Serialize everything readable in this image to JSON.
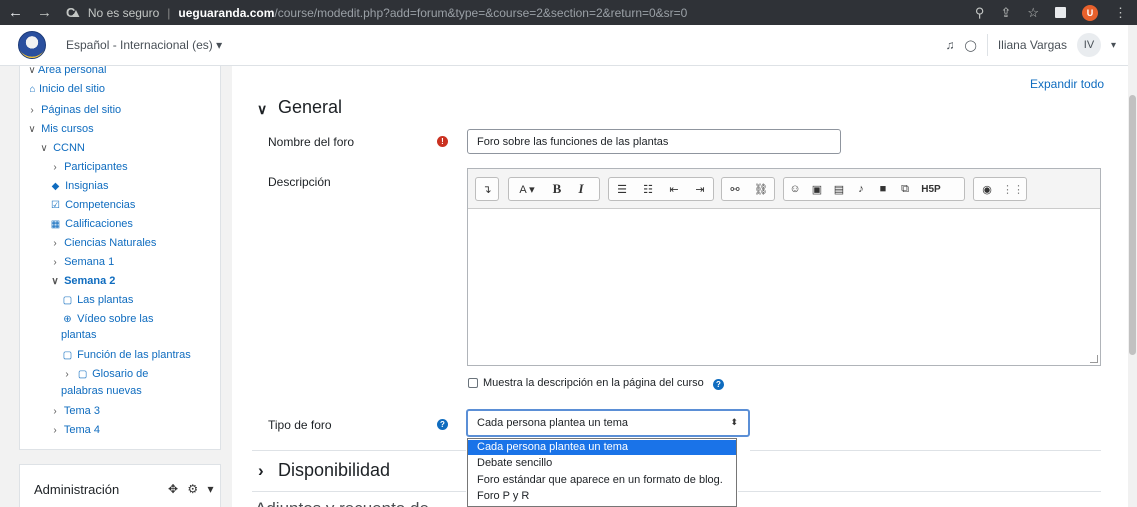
{
  "browser": {
    "back_icon": "←",
    "forward_icon": "→",
    "reload_icon": "C",
    "warning_icon": "▲",
    "security_label": "No es seguro",
    "separator": "|",
    "host": "ueguaranda.com",
    "path": "/course/modedit.php?add=forum&type=&course=2&section=2&return=0&sr=0",
    "profile_initial": "U",
    "zoom_icon": "⚲",
    "share_icon": "⇪",
    "star_icon": "☆",
    "menu_icon": "⋮"
  },
  "navbar": {
    "language": "Español - Internacional (es) ▾",
    "bell_icon": "♫",
    "chat_icon": "◯",
    "user_name": "Iliana Vargas",
    "user_initials": "IV",
    "user_caret": "▾"
  },
  "drawer": {
    "items": [
      {
        "glyph": "∨",
        "icon": "",
        "label": "Área personal"
      },
      {
        "glyph": "",
        "icon": "⌂",
        "label": "Inicio del sitio"
      },
      {
        "glyph": "›",
        "icon": "",
        "label": "Páginas del sitio"
      },
      {
        "glyph": "∨",
        "icon": "",
        "label": "Mis cursos"
      },
      {
        "glyph": "∨",
        "icon": "",
        "label": "CCNN"
      },
      {
        "glyph": "›",
        "icon": "",
        "label": "Participantes"
      },
      {
        "glyph": "",
        "icon": "◆",
        "label": "Insignias"
      },
      {
        "glyph": "",
        "icon": "☑",
        "label": "Competencias"
      },
      {
        "glyph": "",
        "icon": "▦",
        "label": "Calificaciones"
      },
      {
        "glyph": "›",
        "icon": "",
        "label": "Ciencias Naturales"
      },
      {
        "glyph": "›",
        "icon": "",
        "label": "Semana 1"
      },
      {
        "glyph": "∨",
        "icon": "",
        "label": "Semana 2"
      },
      {
        "glyph": "",
        "icon": "▢",
        "label": "Las plantas"
      },
      {
        "glyph": "",
        "icon": "⊕",
        "label": "Vídeo sobre las"
      },
      {
        "glyph": "",
        "icon": "",
        "label": "plantas"
      },
      {
        "glyph": "",
        "icon": "▢",
        "label": "Función de las plantras"
      },
      {
        "glyph": "›",
        "icon": "▢",
        "label": "Glosario de"
      },
      {
        "glyph": "",
        "icon": "",
        "label": "palabras nuevas"
      },
      {
        "glyph": "›",
        "icon": "",
        "label": "Tema 3"
      },
      {
        "glyph": "›",
        "icon": "",
        "label": "Tema 4"
      }
    ],
    "admin_label": "Administración",
    "admin_icons": "✥ ⚙ ▾"
  },
  "main": {
    "expand_all": "Expandir todo",
    "section_general": "General",
    "section_disponibilidad": "Disponibilidad",
    "section_partial": "Adjuntos y recuento de",
    "toggle_open": "∨",
    "toggle_closed": "›",
    "forum_name_label": "Nombre del foro",
    "required_icon": "!",
    "forum_name_value": "Foro sobre las funciones de las plantas",
    "description_label": "Descripción",
    "show_description_label": "Muestra la descripción en la página del curso",
    "help_icon": "?",
    "forum_type_label": "Tipo de foro",
    "forum_type_selected": "Cada persona plantea un tema",
    "forum_type_arrow": "⬍",
    "forum_type_options": [
      "Cada persona plantea un tema",
      "Debate sencillo",
      "Foro estándar que aparece en un formato de blog.",
      "Foro P y R"
    ]
  },
  "editor_toolbar": {
    "toggle": "↴",
    "font": "A ▾",
    "bold": "B",
    "italic": "I",
    "ul": "☰",
    "ol": "☷",
    "outdent": "⇤",
    "indent": "⇥",
    "link": "⚯",
    "unlink": "⛓",
    "emoji": "☺",
    "image": "▣",
    "media": "▤",
    "audio": "♪",
    "video": "■",
    "copy": "⧉",
    "h5p": "H5P",
    "accessibility": "◉",
    "screenreader": "⋮⋮"
  }
}
